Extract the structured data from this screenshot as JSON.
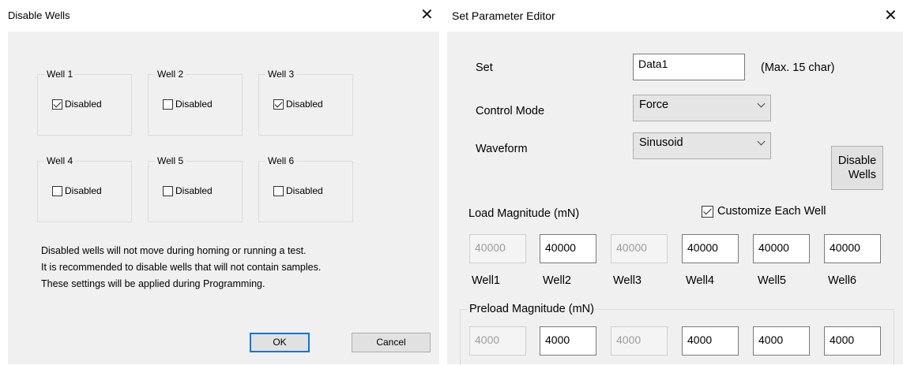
{
  "left_dialog": {
    "title": "Disable Wells",
    "wells": [
      {
        "label": "Well 1",
        "checkbox_label": "Disabled",
        "checked": true
      },
      {
        "label": "Well 2",
        "checkbox_label": "Disabled",
        "checked": false
      },
      {
        "label": "Well 3",
        "checkbox_label": "Disabled",
        "checked": true
      },
      {
        "label": "Well 4",
        "checkbox_label": "Disabled",
        "checked": false
      },
      {
        "label": "Well 5",
        "checkbox_label": "Disabled",
        "checked": false
      },
      {
        "label": "Well 6",
        "checkbox_label": "Disabled",
        "checked": false
      }
    ],
    "note_lines": [
      "Disabled wells will not move during homing or running a test.",
      "It is recommended to disable wells that will not contain samples.",
      "These settings will be applied during Programming."
    ],
    "ok_label": "OK",
    "cancel_label": "Cancel"
  },
  "right_dialog": {
    "title": "Set Parameter Editor",
    "set_label": "Set",
    "set_value": "Data1",
    "set_hint": "(Max. 15 char)",
    "control_mode_label": "Control Mode",
    "control_mode_value": "Force",
    "waveform_label": "Waveform",
    "waveform_value": "Sinusoid",
    "disable_wells_line1": "Disable",
    "disable_wells_line2": "Wells",
    "load_label": "Load Magnitude (mN)",
    "customize_label": "Customize Each Well",
    "customize_checked": true,
    "load_values": [
      "40000",
      "40000",
      "40000",
      "40000",
      "40000",
      "40000"
    ],
    "load_disabled": [
      true,
      false,
      true,
      false,
      false,
      false
    ],
    "well_labels": [
      "Well1",
      "Well2",
      "Well3",
      "Well4",
      "Well5",
      "Well6"
    ],
    "preload_label": "Preload Magnitude (mN)",
    "preload_values": [
      "4000",
      "4000",
      "4000",
      "4000",
      "4000",
      "4000"
    ],
    "preload_disabled": [
      true,
      false,
      true,
      false,
      false,
      false
    ]
  },
  "icons": {
    "close": "close-icon",
    "dropdown": "chevron-down-icon",
    "check": "checkmark-icon"
  }
}
